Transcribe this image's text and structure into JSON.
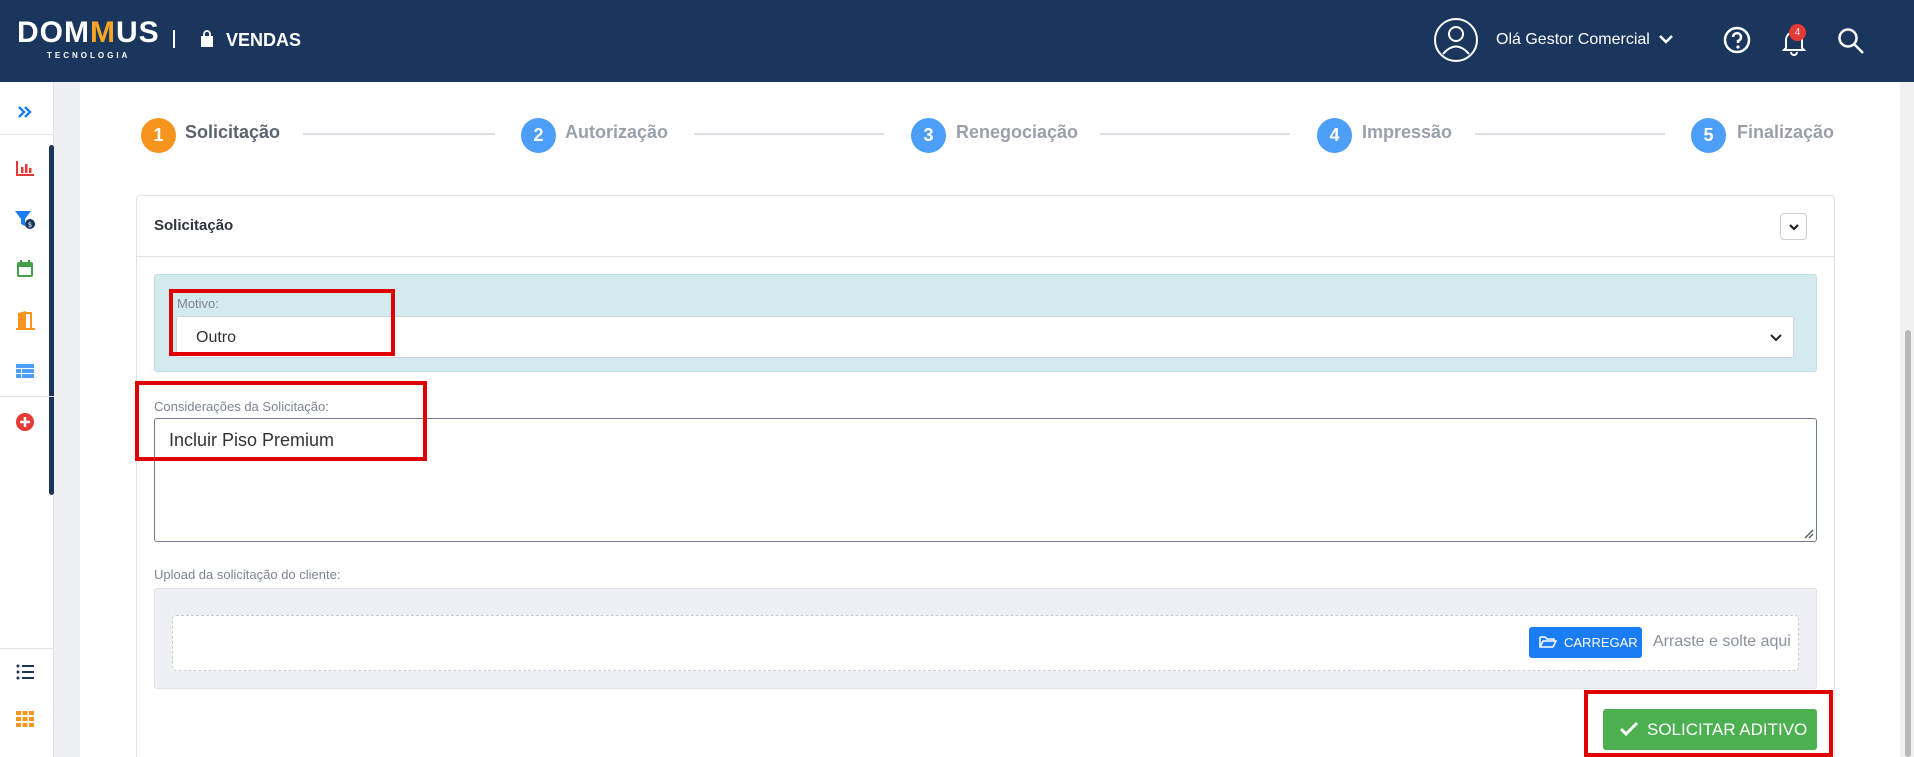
{
  "header": {
    "logo_a": "DOM",
    "logo_mm": "M",
    "logo_b": "US",
    "logo_sub": "TECNOLOGIA",
    "module": "VENDAS",
    "greeting": "Olá Gestor Comercial",
    "notification_count": "4"
  },
  "stepper": {
    "steps": [
      {
        "number": "1",
        "label": "Solicitação",
        "active": true
      },
      {
        "number": "2",
        "label": "Autorização",
        "active": false
      },
      {
        "number": "3",
        "label": "Renegociação",
        "active": false
      },
      {
        "number": "4",
        "label": "Impressão",
        "active": false
      },
      {
        "number": "5",
        "label": "Finalização",
        "active": false
      }
    ]
  },
  "card": {
    "title": "Solicitação",
    "motivo_label": "Motivo:",
    "motivo_value": "Outro",
    "consideracoes_label": "Considerações da Solicitação:",
    "consideracoes_value": "Incluir Piso Premium",
    "upload_label": "Upload da solicitação do cliente:",
    "upload_button": "CARREGAR",
    "drop_hint": "Arraste e solte aqui",
    "submit_button": "SOLICITAR ADITIVO"
  },
  "colors": {
    "topbar": "#1a365d",
    "accent_orange": "#f7941d",
    "step_blue": "#4d9ef7",
    "upload_blue": "#1a7df5",
    "submit_green": "#4caf50",
    "highlight_red": "#e00000"
  },
  "sidebar": {
    "icons": [
      "double-chevron-right-icon",
      "bar-chart-icon",
      "funnel-dollar-icon",
      "calendar-icon",
      "door-icon",
      "table-icon",
      "plus-circle-icon",
      "list-icon",
      "grid-icon"
    ]
  }
}
